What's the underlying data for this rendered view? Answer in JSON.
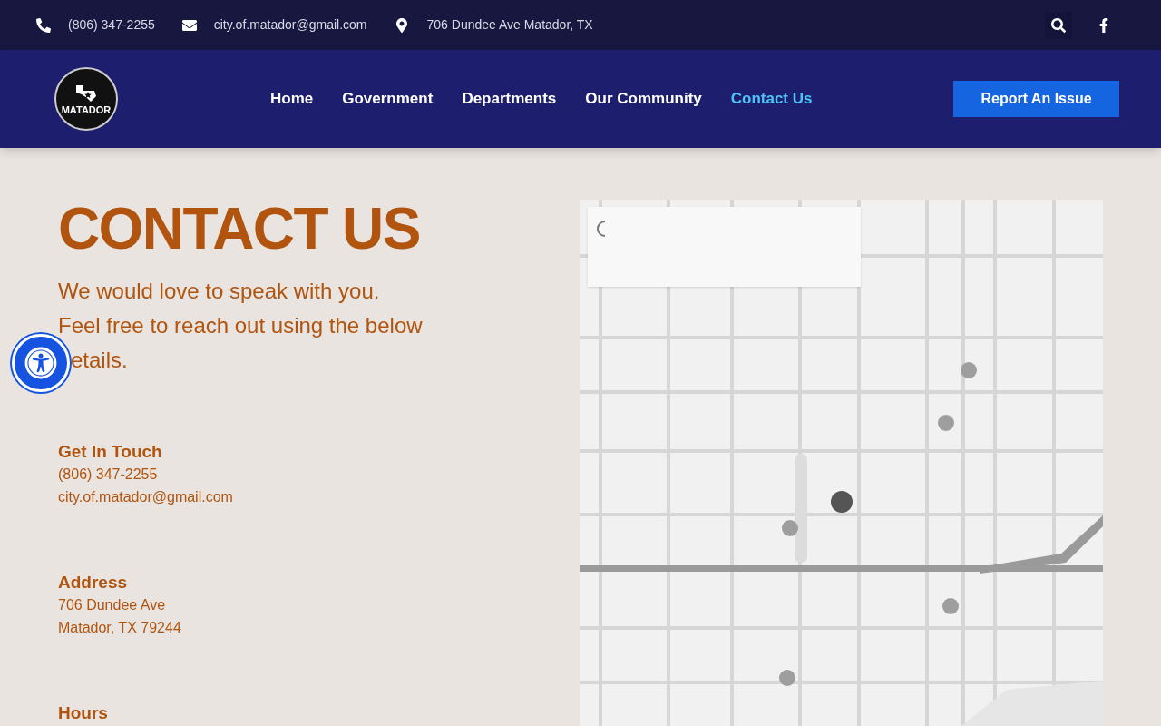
{
  "top_bar": {
    "phone": "(806) 347-2255",
    "email": "city.of.matador@gmail.com",
    "address": "706 Dundee Ave Matador, TX"
  },
  "header": {
    "logo_text": "MATADOR",
    "nav": [
      {
        "label": "Home",
        "selected": false
      },
      {
        "label": "Government",
        "selected": false
      },
      {
        "label": "Departments",
        "selected": false
      },
      {
        "label": "Our Community",
        "selected": false
      },
      {
        "label": "Contact Us",
        "selected": true
      }
    ],
    "cta": "Report An Issue"
  },
  "page": {
    "title": "CONTACT US",
    "intro_lines": [
      "We would love to speak with you.",
      "Feel free to reach out using the below",
      "etails."
    ],
    "sections": [
      {
        "heading": "Get In Touch",
        "lines": [
          "(806) 347-2255",
          "city.of.matador@gmail.com"
        ]
      },
      {
        "heading": "Address",
        "lines": [
          "706 Dundee Ave",
          "Matador, TX 79244"
        ]
      },
      {
        "heading": "Hours"
      }
    ]
  },
  "map": {
    "kind": "picture",
    "loading": true
  }
}
